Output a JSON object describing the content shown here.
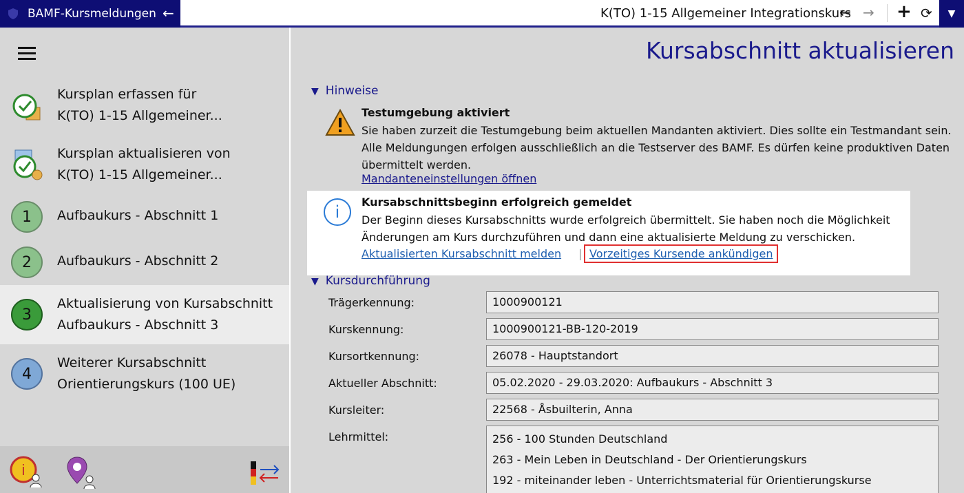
{
  "titlebar": {
    "app_title": "BAMF-Kursmeldungen",
    "course_title": "K(TO) 1-15 Allgemeiner Integrationskurs",
    "colors": {
      "brand": "#0e0e74"
    }
  },
  "sidebar": {
    "items": [
      {
        "line1": "Kursplan erfassen für",
        "line2": "K(TO) 1-15 Allgemeiner..."
      },
      {
        "line1": "Kursplan aktualisieren von",
        "line2": "K(TO) 1-15 Allgemeiner..."
      },
      {
        "number": "1",
        "line1": "Aufbaukurs - Abschnitt 1"
      },
      {
        "number": "2",
        "line1": "Aufbaukurs - Abschnitt 2"
      },
      {
        "number": "3",
        "line1": "Aktualisierung von Kursabschnitt",
        "line2": "Aufbaukurs - Abschnitt 3"
      },
      {
        "number": "4",
        "line1": "Weiterer Kursabschnitt",
        "line2": "Orientierungskurs (100 UE)"
      }
    ]
  },
  "main": {
    "page_title": "Kursabschnitt aktualisieren",
    "hinweise_heading": "Hinweise",
    "warning": {
      "title": "Testumgebung aktiviert",
      "text": "Sie haben zurzeit die Testumgebung beim aktuellen Mandanten aktiviert. Dies sollte ein Testmandant sein. Alle Meldungungen erfolgen ausschließlich an die Testserver des BAMF. Es dürfen keine produktiven Daten übermittelt werden.",
      "link": "Mandanteneinstellungen öffnen"
    },
    "info": {
      "title": "Kursabschnittsbeginn erfolgreich gemeldet",
      "text": "Der Beginn dieses Kursabschnitts wurde erfolgreich übermittelt. Sie haben noch die Möglichkeit Änderungen am Kurs durchzuführen und dann eine aktualisierte Meldung zu verschicken.",
      "link1": "Aktualisierten Kursabschnitt melden",
      "separator": "|",
      "link2": "Vorzeitiges Kursende ankündigen"
    },
    "durchfuehrung_heading": "Kursdurchführung",
    "fields": [
      {
        "label": "Trägerkennung:",
        "value": "1000900121"
      },
      {
        "label": "Kurskennung:",
        "value": "1000900121-BB-120-2019"
      },
      {
        "label": "Kursortkennung:",
        "value": "26078 - Hauptstandort"
      },
      {
        "label": "Aktueller Abschnitt:",
        "value": "05.02.2020 - 29.03.2020: Aufbaukurs - Abschnitt 3"
      },
      {
        "label": "Kursleiter:",
        "value": "22568 - Åsbuilterin, Anna"
      }
    ],
    "lehrmittel": {
      "label": "Lehrmittel:",
      "items": [
        "256 - 100 Stunden Deutschland",
        "263 - Mein Leben in Deutschland - Der Orientierungskurs",
        "192 - miteinander leben - Unterrichtsmaterial für Orientierungskurse"
      ]
    }
  }
}
